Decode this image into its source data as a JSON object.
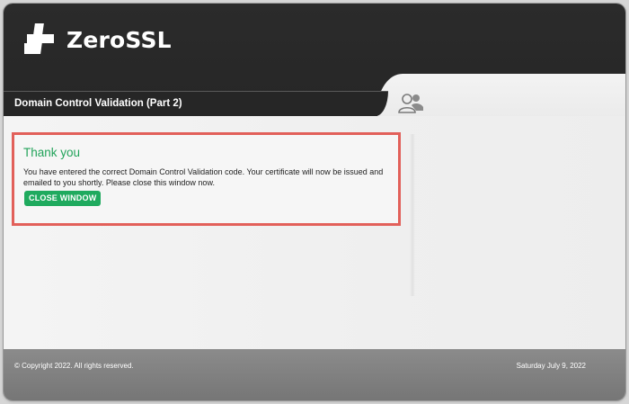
{
  "brand": {
    "name": "ZeroSSL",
    "logo_icon": "zerossl-puzzle-icon"
  },
  "header": {
    "page_title": "Domain Control Validation (Part 2)",
    "account_icon": "users-icon"
  },
  "message": {
    "title": "Thank you",
    "body": "You have entered the correct Domain Control Validation code. Your certificate will now be issued and emailed to you shortly. Please close this window now.",
    "close_button_label": "CLOSE WINDOW"
  },
  "footer": {
    "copyright": "© Copyright 2022. All rights reserved.",
    "date": "Saturday July 9, 2022"
  },
  "colors": {
    "accent_green": "#1faa5e",
    "title_green": "#22a35a",
    "highlight_red": "#e2605a",
    "header_dark": "#262626"
  }
}
